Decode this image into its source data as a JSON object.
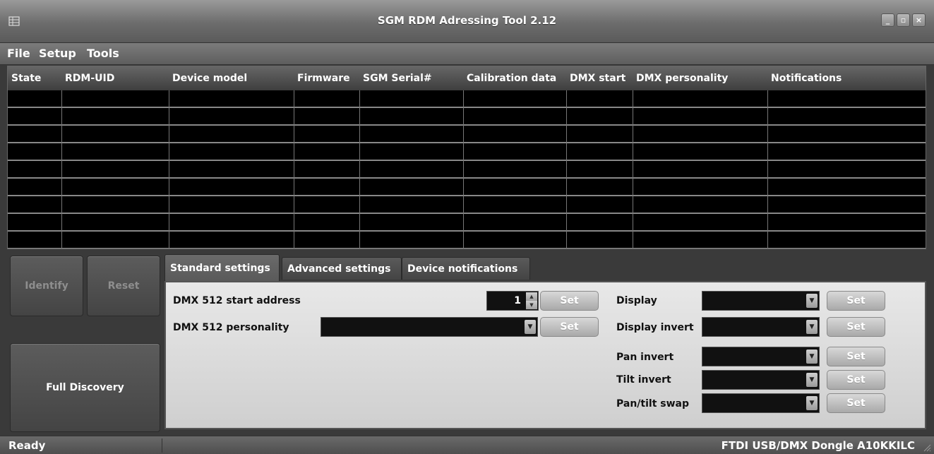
{
  "window": {
    "title": "SGM RDM Adressing Tool 2.12"
  },
  "menu": {
    "items": [
      "File",
      "Setup",
      "Tools"
    ]
  },
  "table": {
    "columns": [
      "State",
      "RDM-UID",
      "Device model",
      "Firmware",
      "SGM Serial#",
      "Calibration data",
      "DMX start",
      "DMX personality",
      "Notifications"
    ],
    "rows": []
  },
  "actions": {
    "identify": "Identify",
    "reset": "Reset",
    "full_discovery": "Full Discovery"
  },
  "tabs": [
    "Standard settings",
    "Advanced settings",
    "Device notifications"
  ],
  "standard": {
    "start_address_label": "DMX 512 start address",
    "start_address_value": "1",
    "personality_label": "DMX 512 personality",
    "personality_value": "",
    "set_label": "Set",
    "display_label": "Display",
    "display_invert_label": "Display invert",
    "pan_invert_label": "Pan invert",
    "tilt_invert_label": "Tilt invert",
    "pan_tilt_swap_label": "Pan/tilt swap"
  },
  "status": {
    "left": "Ready",
    "right": "FTDI USB/DMX Dongle A10KKILC"
  }
}
